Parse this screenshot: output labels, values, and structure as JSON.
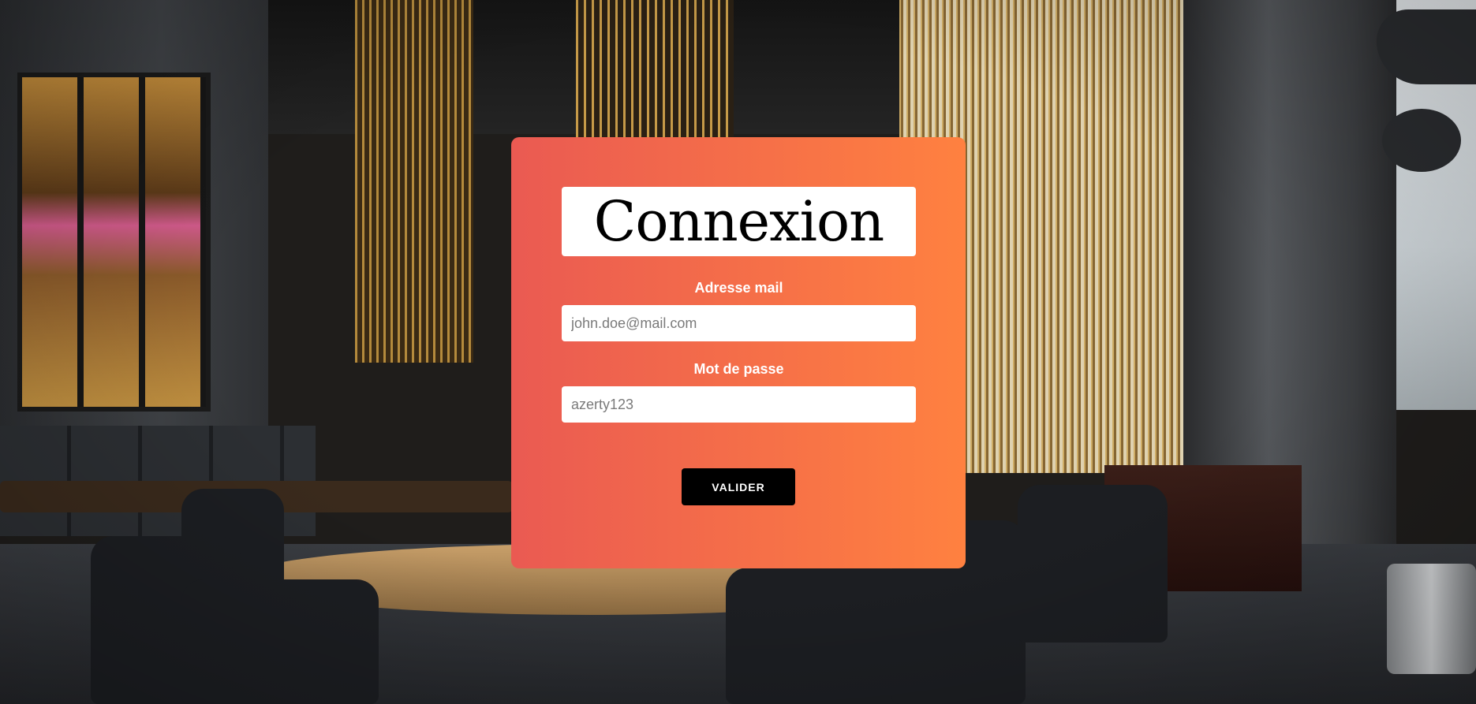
{
  "login": {
    "title": "Connexion",
    "email_label": "Adresse mail",
    "email_placeholder": "john.doe@mail.com",
    "password_label": "Mot de passe",
    "password_placeholder": "azerty123",
    "submit_label": "VALIDER"
  },
  "colors": {
    "card_gradient_start": "#ea5a52",
    "card_gradient_end": "#ff8140",
    "button_background": "#000000"
  }
}
